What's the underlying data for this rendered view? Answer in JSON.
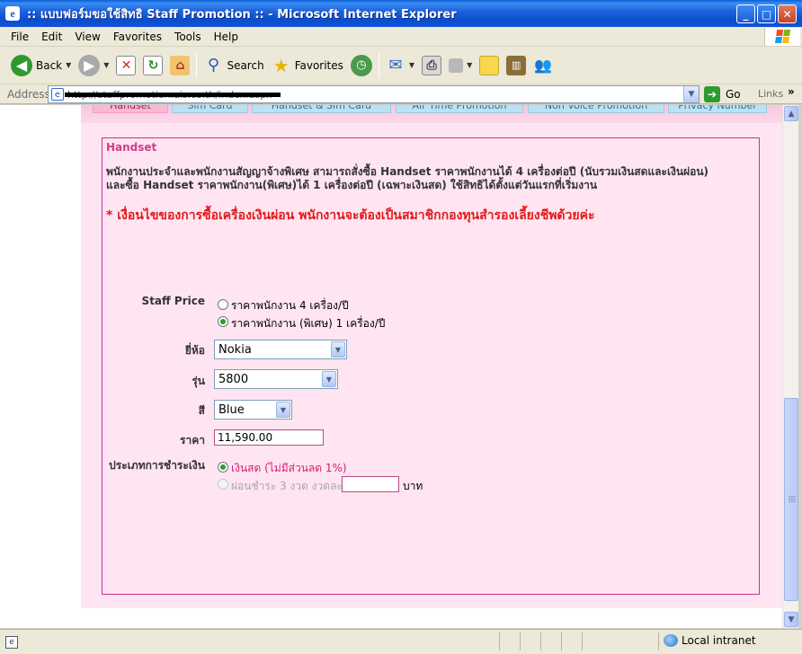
{
  "window": {
    "title": ":: แบบฟอร์มขอใช้สิทธิ Staff Promotion :: - Microsoft Internet Explorer",
    "minimize": "_",
    "maximize": "□",
    "close": "✕"
  },
  "menu": [
    "File",
    "Edit",
    "View",
    "Favorites",
    "Tools",
    "Help"
  ],
  "toolbar": {
    "back_label": "Back",
    "search_label": "Search",
    "favorites_label": "Favorites"
  },
  "address": {
    "label": "Address",
    "url": "http://staffpromotion.ais.co.th/index.aspx",
    "go_label": "Go",
    "links_label": "Links"
  },
  "tabs": [
    {
      "label": "Handset",
      "active": true
    },
    {
      "label": "Sim Card",
      "active": false
    },
    {
      "label": "Handset & Sim Card",
      "active": false
    },
    {
      "label": "Air Time Promotion",
      "active": false
    },
    {
      "label": "Non Voice Promotion",
      "active": false
    },
    {
      "label": "Privacy Number",
      "active": false
    }
  ],
  "section": {
    "title": "Handset",
    "desc_line1": "พนักงานประจำและพนักงานสัญญาจ้างพิเศษ  สามารถสั่งซื้อ Handset ราคาพนักงานได้ 4 เครื่องต่อปี (นับรวมเงินสดและเงินผ่อน)",
    "desc_line2": "และซื้อ Handset ราคาพนักงาน(พิเศษ)ได้ 1 เครื่องต่อปี (เฉพาะเงินสด)  ใช้สิทธิได้ตั้งแต่วันแรกที่เริ่มงาน",
    "warning": "* เงื่อนไขของการซื้อเครื่องเงินผ่อน  พนักงานจะต้องเป็นสมาชิกกองทุนสำรองเลี้ยงชีพด้วยค่ะ"
  },
  "form": {
    "staff_price_label": "Staff Price",
    "staff_price_options": [
      {
        "label": "ราคาพนักงาน 4 เครื่อง/ปี",
        "checked": false
      },
      {
        "label": "ราคาพนักงาน (พิเศษ) 1 เครื่อง/ปี",
        "checked": true
      }
    ],
    "brand_label": "ยี่ห้อ",
    "brand_value": "Nokia",
    "model_label": "รุ่น",
    "model_value": "5800",
    "color_label": "สี",
    "color_value": "Blue",
    "price_label": "ราคา",
    "price_value": "11,590.00",
    "payment_label": "ประเภทการชำระเงิน",
    "payment_cash": "เงินสด (ไม่มีส่วนลด 1%)",
    "payment_installment": "ผ่อนชำระ 3 งวด งวดละ",
    "installment_value": "",
    "currency_label": "บาท"
  },
  "status": {
    "zone": "Local intranet"
  },
  "colors": {
    "accent_pink": "#cf3c8e",
    "warning_red": "#e01a1a",
    "page_bg": "#ffe5f2",
    "selected_radio": "#2e9e2e"
  }
}
